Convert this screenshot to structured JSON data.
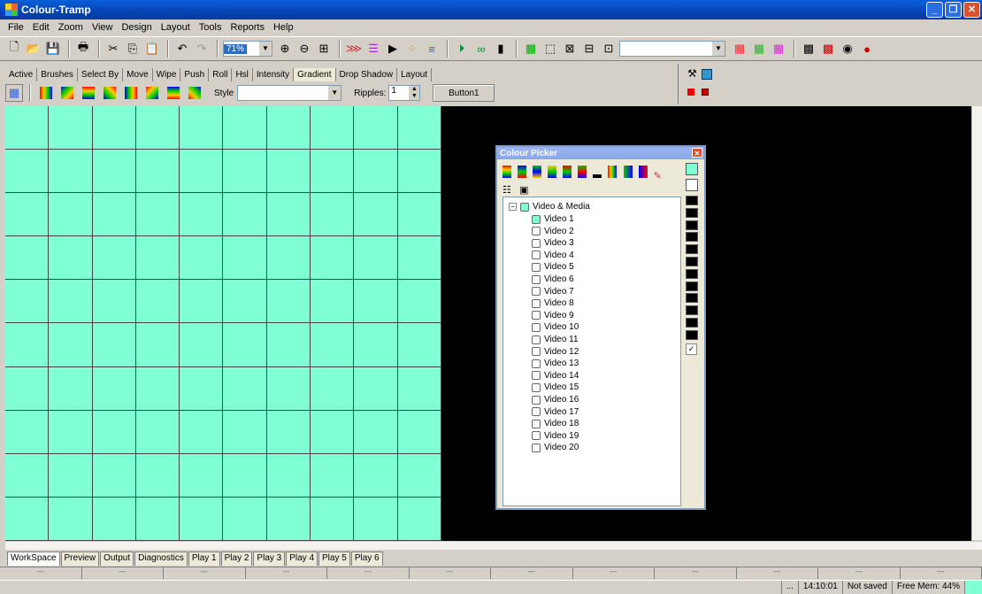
{
  "window": {
    "title": "Colour-Tramp"
  },
  "menu": [
    "File",
    "Edit",
    "Zoom",
    "View",
    "Design",
    "Layout",
    "Tools",
    "Reports",
    "Help"
  ],
  "toolbar": {
    "zoom_value": "71%"
  },
  "tabs": [
    "Active",
    "Brushes",
    "Select By",
    "Move",
    "Wipe",
    "Push",
    "Roll",
    "Hsl",
    "Intensity",
    "Gradient",
    "Drop Shadow",
    "Layout"
  ],
  "selected_tab": "Gradient",
  "style_label": "Style",
  "ripples": {
    "label": "Ripples:",
    "value": "1"
  },
  "button1_label": "Button1",
  "picker": {
    "title": "Colour Picker",
    "root": "Video & Media",
    "items": [
      "Video 1",
      "Video 2",
      "Video 3",
      "Video 4",
      "Video 5",
      "Video 6",
      "Video 7",
      "Video 8",
      "Video 9",
      "Video 10",
      "Video 11",
      "Video 12",
      "Video 13",
      "Video 14",
      "Video 15",
      "Video 16",
      "Video 17",
      "Video 18",
      "Video 19",
      "Video 20"
    ],
    "checked_item": "Video 1"
  },
  "bottom_tabs": [
    "WorkSpace",
    "Preview",
    "Output",
    "Diagnostics",
    "Play 1",
    "Play 2",
    "Play 3",
    "Play 4",
    "Play 5",
    "Play 6"
  ],
  "status": {
    "ellipsis": "...",
    "time": "14:10:01",
    "saved": "Not saved",
    "mem": "Free Mem: 44%",
    "dashes": "---"
  },
  "colors": {
    "accent": "#80ffd4",
    "titlebar": "#0743b5"
  }
}
